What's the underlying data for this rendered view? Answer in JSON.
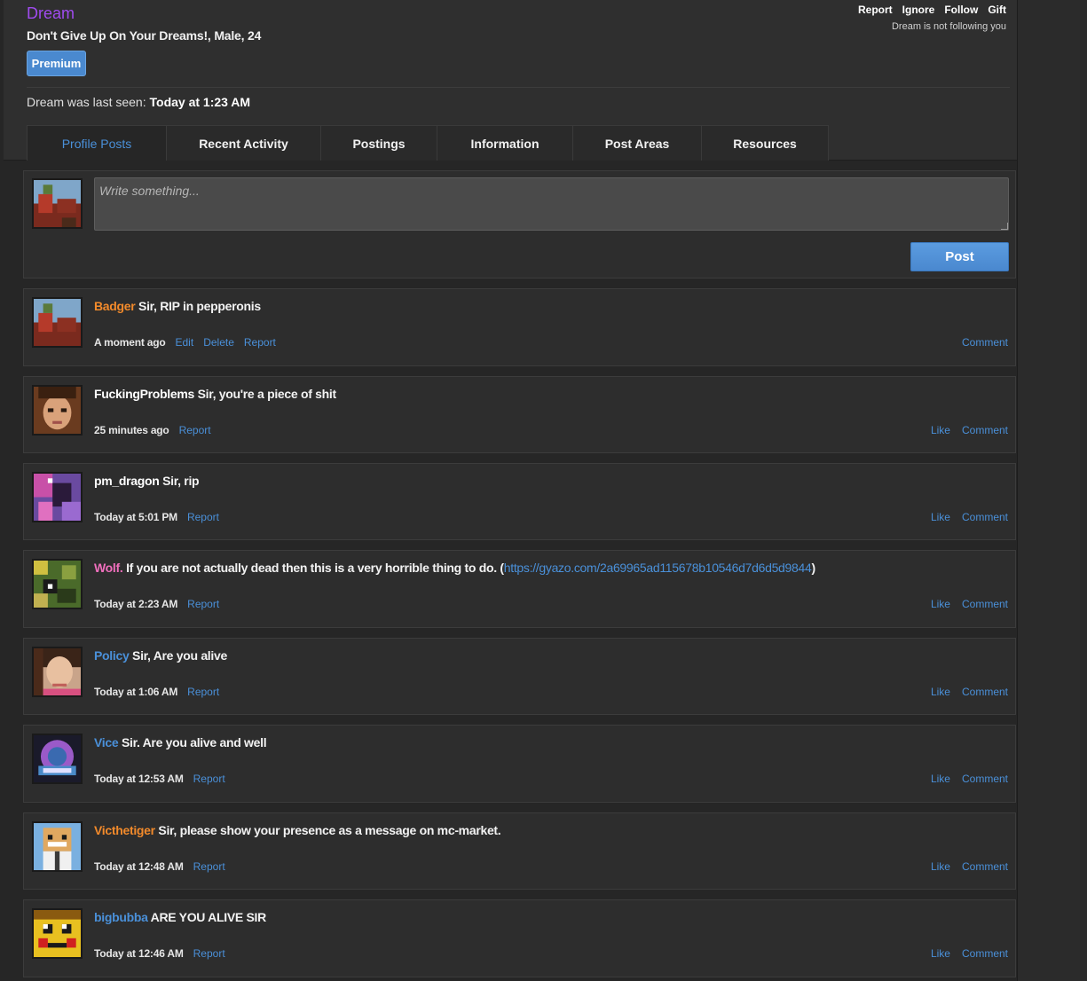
{
  "profile": {
    "username": "Dream",
    "blurb": "Don't Give Up On Your Dreams!, Male, 24",
    "badge": "Premium",
    "last_seen_label": "Dream was last seen:",
    "last_seen_value": "Today at 1:23 AM",
    "follow_status": "Dream is not following you",
    "username_color": "#a04bef"
  },
  "header_actions": [
    "Report",
    "Ignore",
    "Follow",
    "Gift"
  ],
  "tabs": [
    {
      "label": "Profile Posts",
      "active": true
    },
    {
      "label": "Recent Activity",
      "active": false
    },
    {
      "label": "Postings",
      "active": false
    },
    {
      "label": "Information",
      "active": false
    },
    {
      "label": "Post Areas",
      "active": false
    },
    {
      "label": "Resources",
      "active": false
    }
  ],
  "composer": {
    "placeholder": "Write something...",
    "post_label": "Post"
  },
  "posts": [
    {
      "author": "Badger",
      "author_color": "orange",
      "text": "Sir, RIP in pepperonis",
      "link": "",
      "after": "",
      "time": "A moment ago",
      "meta_links": [
        "Edit",
        "Delete",
        "Report"
      ],
      "actions": [
        "Comment"
      ]
    },
    {
      "author": "FuckingProblems",
      "author_color": "white",
      "text": "Sir, you're a piece of shit",
      "link": "",
      "after": "",
      "time": "25 minutes ago",
      "meta_links": [
        "Report"
      ],
      "actions": [
        "Like",
        "Comment"
      ]
    },
    {
      "author": "pm_dragon",
      "author_color": "white",
      "text": "Sir, rip",
      "link": "",
      "after": "",
      "time": "Today at 5:01 PM",
      "meta_links": [
        "Report"
      ],
      "actions": [
        "Like",
        "Comment"
      ]
    },
    {
      "author": "Wolf.",
      "author_color": "pink",
      "text": "If you are not actually dead then this is a very horrible thing to do. (",
      "link": "https://gyazo.com/2a69965ad115678b10546d7d6d5d9844",
      "after": ")",
      "time": "Today at 2:23 AM",
      "meta_links": [
        "Report"
      ],
      "actions": [
        "Like",
        "Comment"
      ]
    },
    {
      "author": "Policy",
      "author_color": "blue",
      "text": "Sir, Are you alive",
      "link": "",
      "after": "",
      "time": "Today at 1:06 AM",
      "meta_links": [
        "Report"
      ],
      "actions": [
        "Like",
        "Comment"
      ]
    },
    {
      "author": "Vice",
      "author_color": "blue",
      "text": "Sir. Are you alive and well",
      "link": "",
      "after": "",
      "time": "Today at 12:53 AM",
      "meta_links": [
        "Report"
      ],
      "actions": [
        "Like",
        "Comment"
      ]
    },
    {
      "author": "Victhetiger",
      "author_color": "orange",
      "text": "Sir, please show your presence as a message on mc-market.",
      "link": "",
      "after": "",
      "time": "Today at 12:48 AM",
      "meta_links": [
        "Report"
      ],
      "actions": [
        "Like",
        "Comment"
      ]
    },
    {
      "author": "bigbubba",
      "author_color": "blue",
      "text": "ARE YOU ALIVE SIR",
      "link": "",
      "after": "",
      "time": "Today at 12:46 AM",
      "meta_links": [
        "Report"
      ],
      "actions": [
        "Like",
        "Comment"
      ]
    }
  ],
  "colors": {
    "accent_blue": "#4a90d9",
    "orange_name": "#f28a2b",
    "pink_name": "#f06fbd",
    "background": "#262626"
  }
}
